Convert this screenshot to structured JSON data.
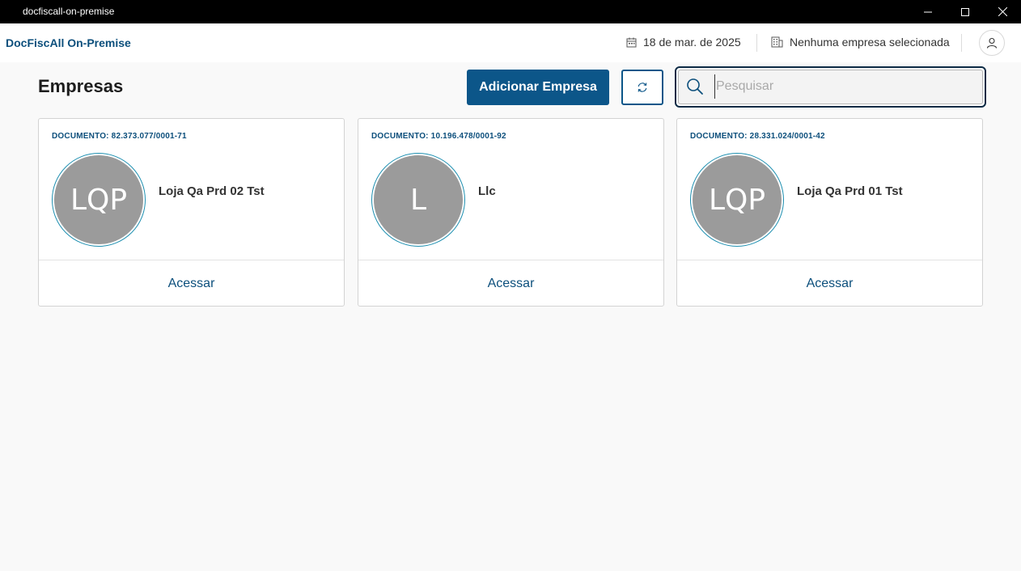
{
  "window": {
    "title": "docfiscall-on-premise",
    "controls": [
      "minimize-icon",
      "maximize-icon",
      "close-icon"
    ]
  },
  "header": {
    "brand": "DocFiscAll On-Premise",
    "date": "18 de mar. de 2025",
    "company_status": "Nenhuma empresa selecionada",
    "icons": [
      "calendar-icon",
      "building-icon",
      "user-icon"
    ]
  },
  "toolbar": {
    "title": "Empresas",
    "add_label": "Adicionar Empresa",
    "search_placeholder": "Pesquisar",
    "search_value": ""
  },
  "cards": [
    {
      "document": "DOCUMENTO: 82.373.077/0001-71",
      "initials": "LQP",
      "name": "Loja Qa Prd 02 Tst",
      "action": "Acessar"
    },
    {
      "document": "DOCUMENTO: 10.196.478/0001-92",
      "initials": "L",
      "name": "Llc",
      "action": "Acessar"
    },
    {
      "document": "DOCUMENTO: 28.331.024/0001-42",
      "initials": "LQP",
      "name": "Loja Qa Prd 01 Tst",
      "action": "Acessar"
    }
  ],
  "colors": {
    "brand": "#0c4f7c",
    "primary_button": "#0c5689",
    "avatar_bg": "#9b9b9b",
    "avatar_ring": "#1e8fb0"
  }
}
